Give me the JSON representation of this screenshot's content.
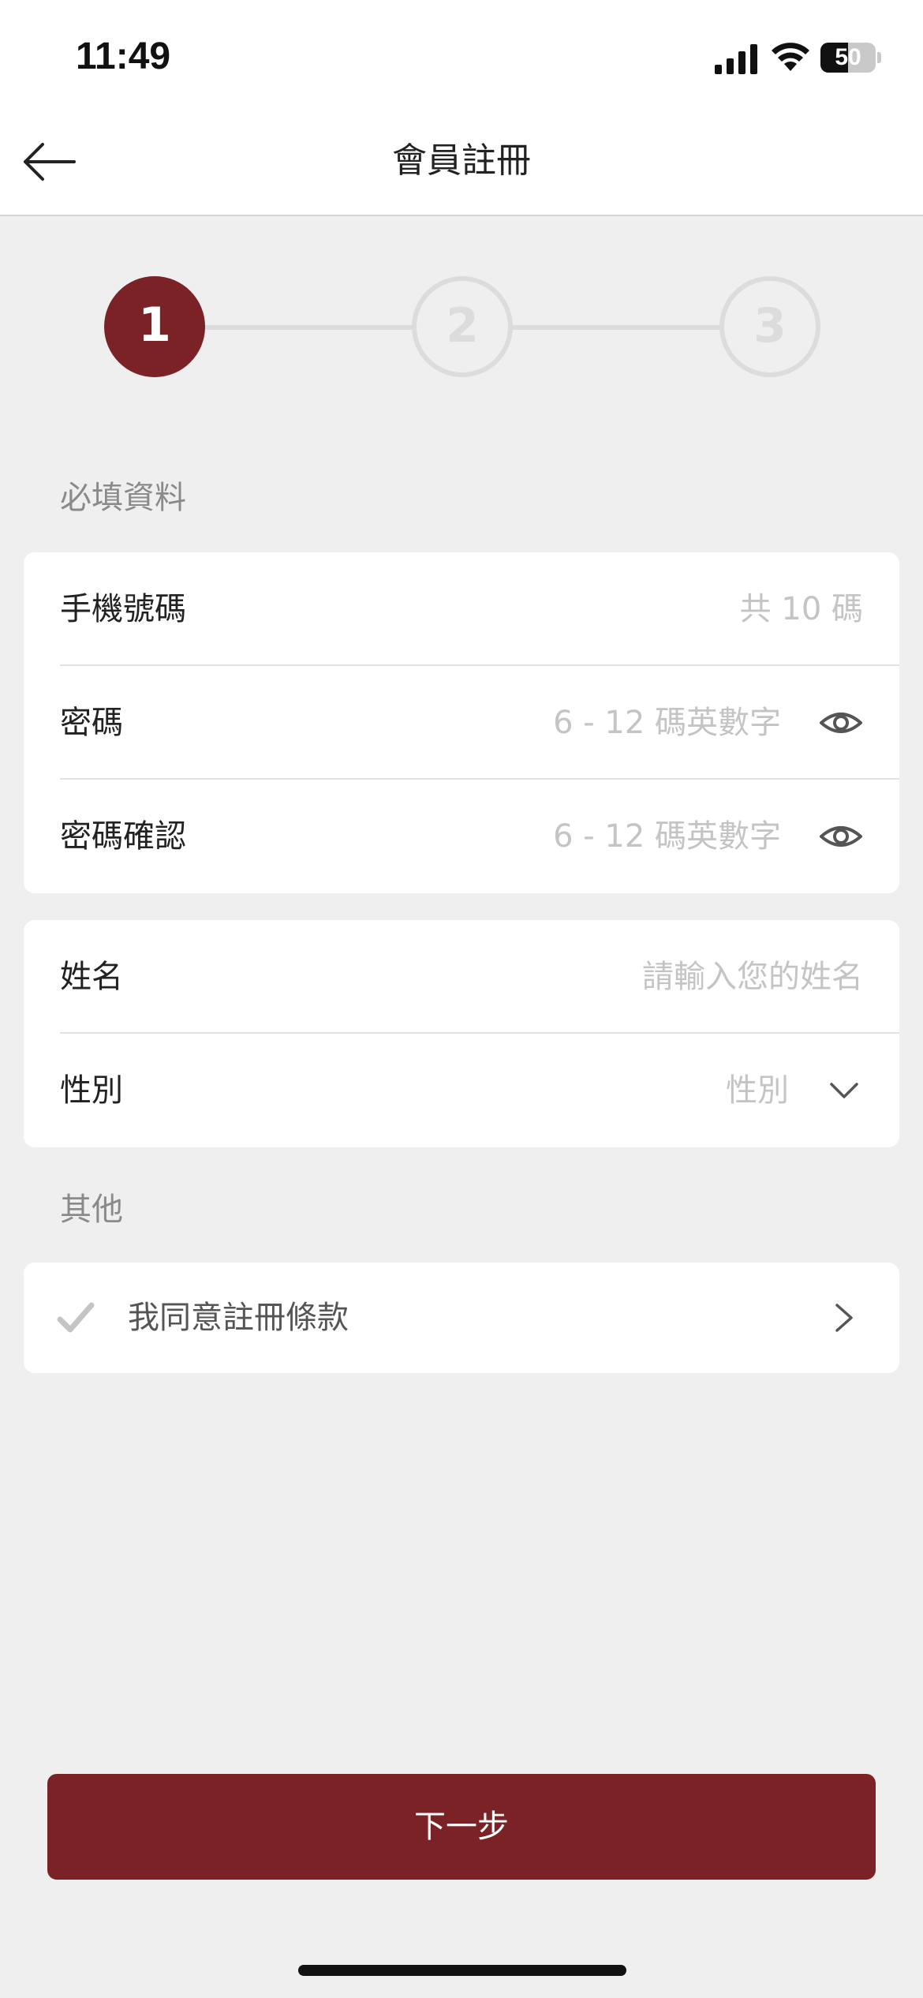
{
  "status_bar": {
    "time": "11:49",
    "battery": "50",
    "battery_level": 0.5
  },
  "nav": {
    "title": "會員註冊",
    "back_icon": "arrow-left-icon"
  },
  "stepper": {
    "current_step": 1,
    "steps": [
      "1",
      "2",
      "3"
    ]
  },
  "required_section": {
    "label": "必填資料"
  },
  "account_card": {
    "phone": {
      "label": "手機號碼",
      "placeholder": "共 10 碼",
      "value": ""
    },
    "password": {
      "label": "密碼",
      "placeholder": "6 - 12 碼英數字",
      "value": ""
    },
    "password_confirm": {
      "label": "密碼確認",
      "placeholder": "6 - 12 碼英數字",
      "value": ""
    }
  },
  "profile_card": {
    "name": {
      "label": "姓名",
      "placeholder": "請輸入您的姓名",
      "value": ""
    },
    "gender": {
      "label": "性別",
      "selected": "性別"
    }
  },
  "other_section": {
    "label": "其他"
  },
  "terms": {
    "label": "我同意註冊條款",
    "checked": false
  },
  "next_button": {
    "label": "下一步"
  },
  "colors": {
    "accent": "#7a2226",
    "background": "#efefef",
    "placeholder": "#c4c4c4",
    "inactive_step": "#dcdcdc"
  }
}
